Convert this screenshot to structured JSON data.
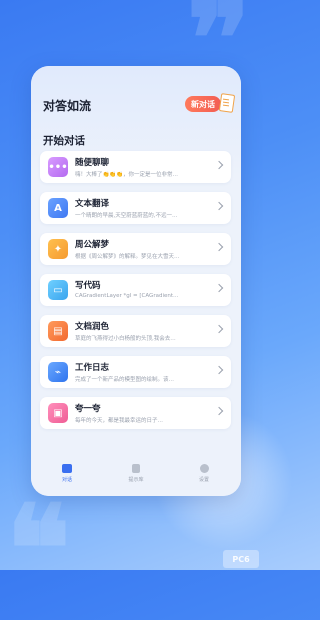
{
  "app": {
    "title": "对答如流",
    "new_chat_label": "新对话",
    "section_title": "开始对话"
  },
  "items": [
    {
      "title": "随便聊聊",
      "desc": "嗨！大棒了👏👏👏，你一定是一位非常…",
      "icon": "chat-bubble-icon",
      "color": "#c684f2"
    },
    {
      "title": "文本翻译",
      "desc": "一个晴朗的早晨,天空蔚蓝蔚蓝的,不远一…",
      "icon": "translate-icon",
      "color": "#4f8df7"
    },
    {
      "title": "周公解梦",
      "desc": "根据《周公解梦》的解释。梦见在大雪天…",
      "icon": "lightbulb-icon",
      "color": "#f5a63b"
    },
    {
      "title": "写代码",
      "desc": "CAGradientLayer *gl = [CAGradient…",
      "icon": "code-window-icon",
      "color": "#49b7f2"
    },
    {
      "title": "文档润色",
      "desc": "草庭的飞燕得过小白杨般的头顶,我会去…",
      "icon": "document-icon",
      "color": "#f57a3b"
    },
    {
      "title": "工作日志",
      "desc": "完成了一个新产品的模型图的绘制。该…",
      "icon": "chart-monitor-icon",
      "color": "#3f88f5"
    },
    {
      "title": "夸一夸",
      "desc": "每年的今天，都是我最幸运的日子…",
      "icon": "gift-box-icon",
      "color": "#f26fa0"
    }
  ],
  "tabs": [
    {
      "label": "对话",
      "icon": "chat-tab-icon",
      "active": true
    },
    {
      "label": "提示库",
      "icon": "library-tab-icon",
      "active": false
    },
    {
      "label": "设置",
      "icon": "settings-tab-icon",
      "active": false
    }
  ],
  "watermark": "PC6"
}
